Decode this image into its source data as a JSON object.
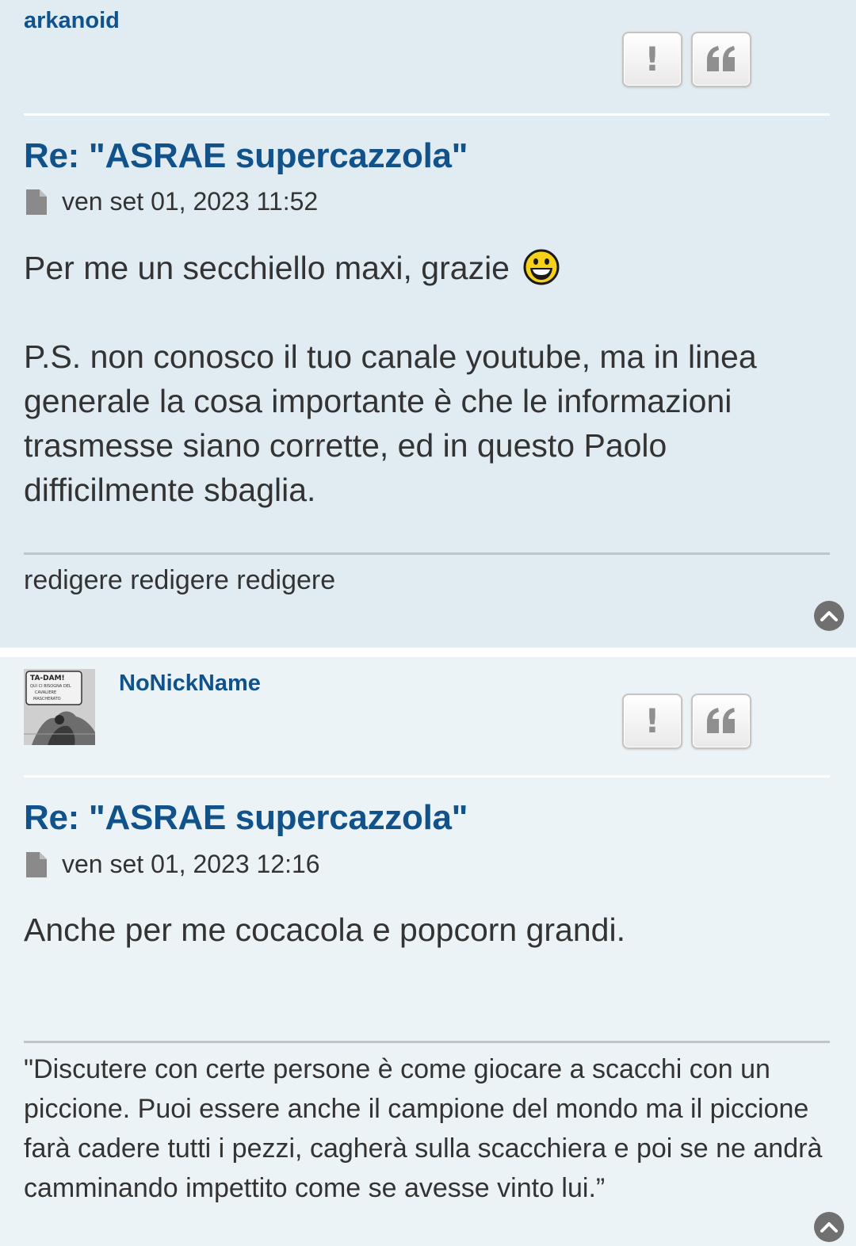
{
  "posts": [
    {
      "author": "arkanoid",
      "report_label": "!",
      "title": "Re: \"ASRAE supercazzola\"",
      "date": "ven set 01, 2023 11:52",
      "content": {
        "line1": "Per me un secchiello maxi, grazie",
        "smiley": "laughing-smiley",
        "paragraph2": "P.S. non conosco il tuo canale youtube, ma in linea generale la cosa importante è che le informazioni trasmesse siano corrette, ed in questo Paolo difficilmente sbaglia."
      },
      "signature": "redigere redigere redigere"
    },
    {
      "author": "NoNickName",
      "avatar": {
        "caption_line1": "TA-DAM!",
        "caption_line2": "QUI CI BISOGNA DEL",
        "caption_line3": "CAVALIERE",
        "caption_line4": "MASCHERATO"
      },
      "report_label": "!",
      "title": "Re: \"ASRAE supercazzola\"",
      "date": "ven set 01, 2023 12:16",
      "content": {
        "line1": "Anche per me cocacola e popcorn grandi."
      },
      "signature": "\"Discutere con certe persone è come giocare a scacchi con un piccione. Puoi essere anche il campione del mondo ma il piccione farà cadere tutti i pezzi, cagherà sulla scacchiera e poi se ne andrà camminando impettito come se avesse vinto lui.”"
    }
  ],
  "icons": {
    "report": "exclamation-icon",
    "quote": "quote-icon",
    "post": "document-icon",
    "back_to_top": "chevron-up-icon"
  },
  "colors": {
    "post_bg_1": "#e1ebf2",
    "post_bg_2": "#ecf3f7",
    "link": "#105289",
    "text": "#333333"
  }
}
